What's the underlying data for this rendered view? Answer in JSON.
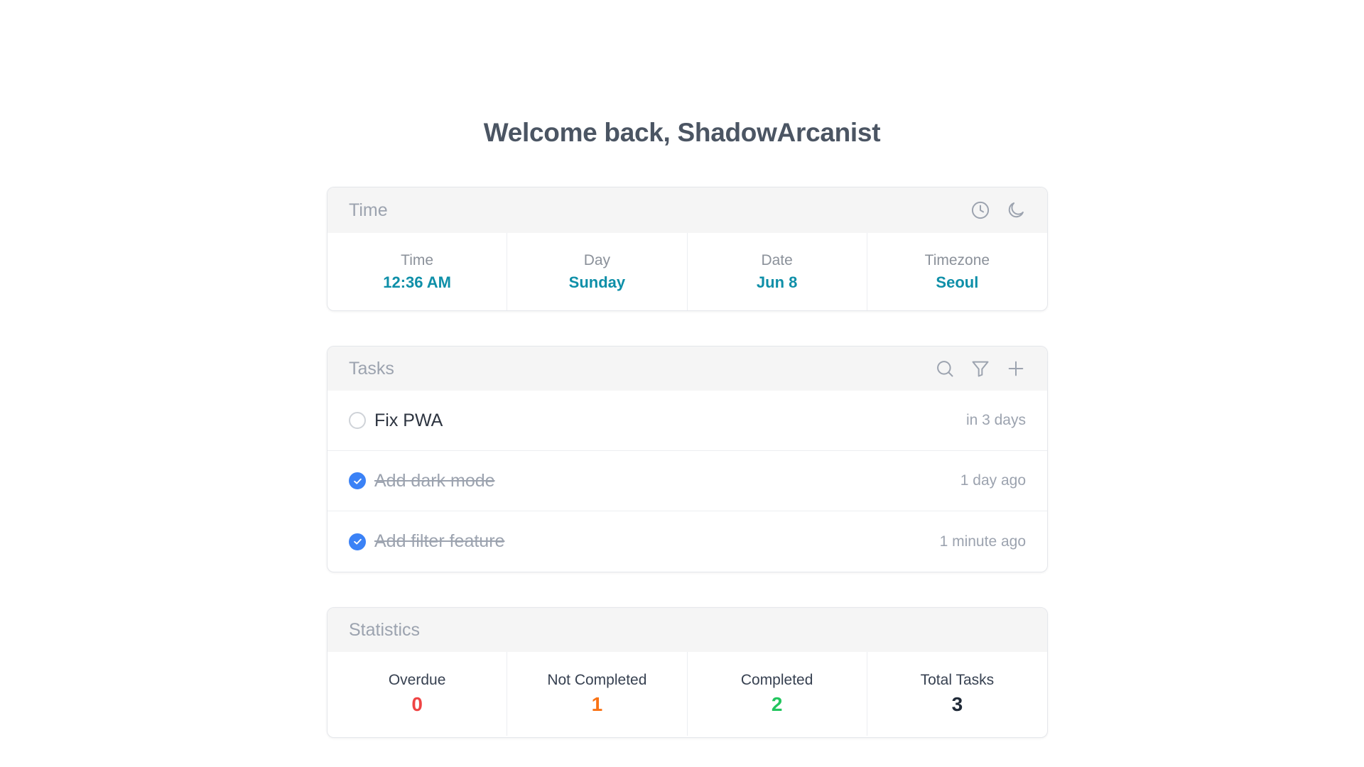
{
  "welcome": {
    "text": "Welcome back, ShadowArcanist"
  },
  "time_card": {
    "title": "Time",
    "icons": [
      "clock-icon",
      "moon-icon"
    ],
    "cells": [
      {
        "label": "Time",
        "value": "12:36 AM"
      },
      {
        "label": "Day",
        "value": "Sunday"
      },
      {
        "label": "Date",
        "value": "Jun 8"
      },
      {
        "label": "Timezone",
        "value": "Seoul"
      }
    ],
    "value_color": "#0e8fa8"
  },
  "tasks_card": {
    "title": "Tasks",
    "icons": [
      "search-icon",
      "filter-icon",
      "plus-icon"
    ],
    "tasks": [
      {
        "name": "Fix PWA",
        "time": "in 3 days",
        "completed": false
      },
      {
        "name": "Add dark mode",
        "time": "1 day ago",
        "completed": true
      },
      {
        "name": "Add filter feature",
        "time": "1 minute ago",
        "completed": true
      }
    ],
    "check_color": "#3b82f6"
  },
  "stats_card": {
    "title": "Statistics",
    "stats": [
      {
        "label": "Overdue",
        "value": "0",
        "color": "#ef4444"
      },
      {
        "label": "Not Completed",
        "value": "1",
        "color": "#f97316"
      },
      {
        "label": "Completed",
        "value": "2",
        "color": "#22c55e"
      },
      {
        "label": "Total Tasks",
        "value": "3",
        "color": "#1f2937"
      }
    ]
  }
}
